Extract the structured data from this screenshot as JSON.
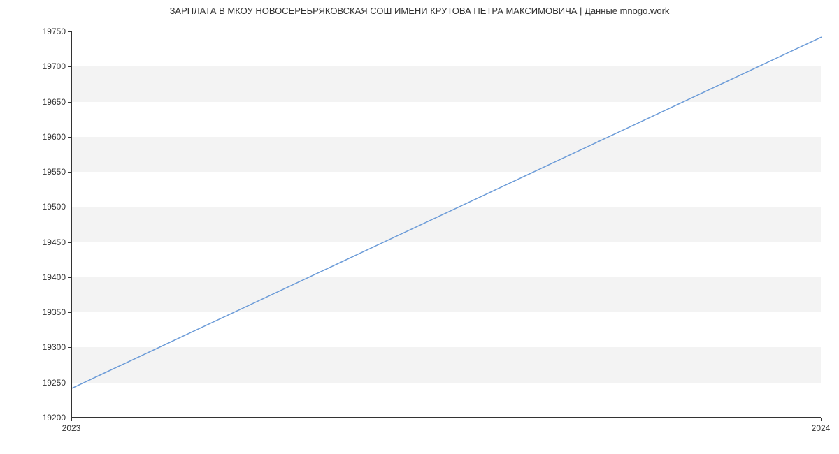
{
  "chart_data": {
    "type": "line",
    "title": "ЗАРПЛАТА В МКОУ НОВОСЕРЕБРЯКОВСКАЯ СОШ ИМЕНИ КРУТОВА ПЕТРА МАКСИМОВИЧА | Данные mnogo.work",
    "xlabel": "",
    "ylabel": "",
    "x": [
      2023,
      2024
    ],
    "values": [
      19242,
      19742
    ],
    "x_ticks": [
      2023,
      2024
    ],
    "y_ticks": [
      19200,
      19250,
      19300,
      19350,
      19400,
      19450,
      19500,
      19550,
      19600,
      19650,
      19700,
      19750
    ],
    "xlim": [
      2023,
      2024
    ],
    "ylim": [
      19200,
      19750
    ]
  }
}
